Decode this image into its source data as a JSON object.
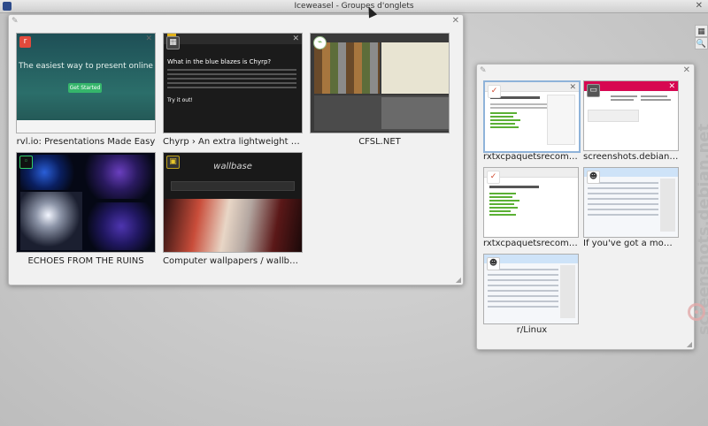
{
  "window": {
    "title": "Iceweasel - Groupes d'onglets"
  },
  "side_tools": {
    "groups_icon": "tab-groups-icon",
    "search_icon": "search-icon"
  },
  "watermark": {
    "text": "screenshots.debian.net"
  },
  "group_left": {
    "tabs": [
      {
        "title": "rvl.io: Presentations Made Easy",
        "favicon": "rvl",
        "thumb_heading": "The easiest way to present online",
        "thumb_button": "Get Started"
      },
      {
        "title": "Chyrp › An extra lightweight and e...",
        "favicon": "chyrp",
        "thumb_heading": "What in the blue blazes is Chyrp?",
        "thumb_button": "Try it out!"
      },
      {
        "title": "CFSL.NET",
        "favicon": "cfsl"
      },
      {
        "title": "ECHOES FROM THE RUINS",
        "favicon": "echoes"
      },
      {
        "title": "Computer wallpapers / wallbase.cc",
        "favicon": "wallbase",
        "thumb_logo": "wallbase"
      }
    ]
  },
  "group_right": {
    "tabs": [
      {
        "title": "rxtxcpaquetsrecomma...",
        "favicon": "rxtx"
      },
      {
        "title": "screenshots.debian.net",
        "favicon": "debian"
      },
      {
        "title": "rxtxcpaquetsrecomma...",
        "favicon": "rxtx"
      },
      {
        "title": "If you've got a momen...",
        "favicon": "reddit"
      },
      {
        "title": "r/Linux",
        "favicon": "reddit"
      }
    ]
  },
  "colors": {
    "background": "#c9c9c9",
    "group_bg": "#f1f1f1",
    "accent_green": "#35b56b",
    "debian_red": "#d70751"
  }
}
